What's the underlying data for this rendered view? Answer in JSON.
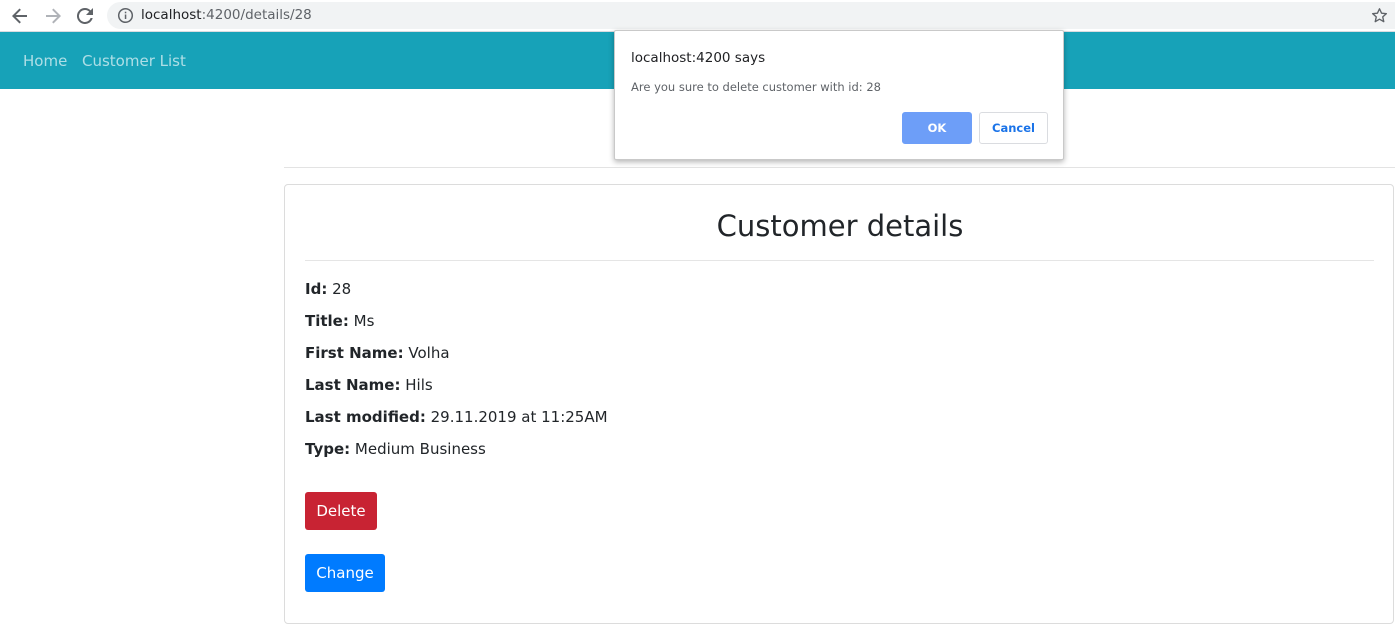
{
  "browser": {
    "url_host": "localhost",
    "url_path": ":4200/details/28"
  },
  "navbar": {
    "home_label": "Home",
    "customer_list_label": "Customer List",
    "color": "#17a2b8"
  },
  "card": {
    "title": "Customer details",
    "fields": [
      {
        "label": "Id:",
        "value": "28"
      },
      {
        "label": "Title:",
        "value": "Ms"
      },
      {
        "label": "First Name:",
        "value": "Volha"
      },
      {
        "label": "Last Name:",
        "value": "Hils"
      },
      {
        "label": "Last modified:",
        "value": "29.11.2019 at 11:25AM"
      },
      {
        "label": "Type:",
        "value": "Medium Business"
      }
    ],
    "delete_label": "Delete",
    "change_label": "Change"
  },
  "dialog": {
    "title": "localhost:4200 says",
    "message": "Are you sure to delete customer with id: 28",
    "ok_label": "OK",
    "cancel_label": "Cancel"
  },
  "icons": {
    "back": "arrow-left-icon",
    "forward": "arrow-right-icon",
    "reload": "reload-icon",
    "site_info": "info-icon",
    "bookmark": "star-icon"
  },
  "colors": {
    "delete": "#c82333",
    "change": "#007bff",
    "dialog_ok": "#6d9ef8"
  }
}
